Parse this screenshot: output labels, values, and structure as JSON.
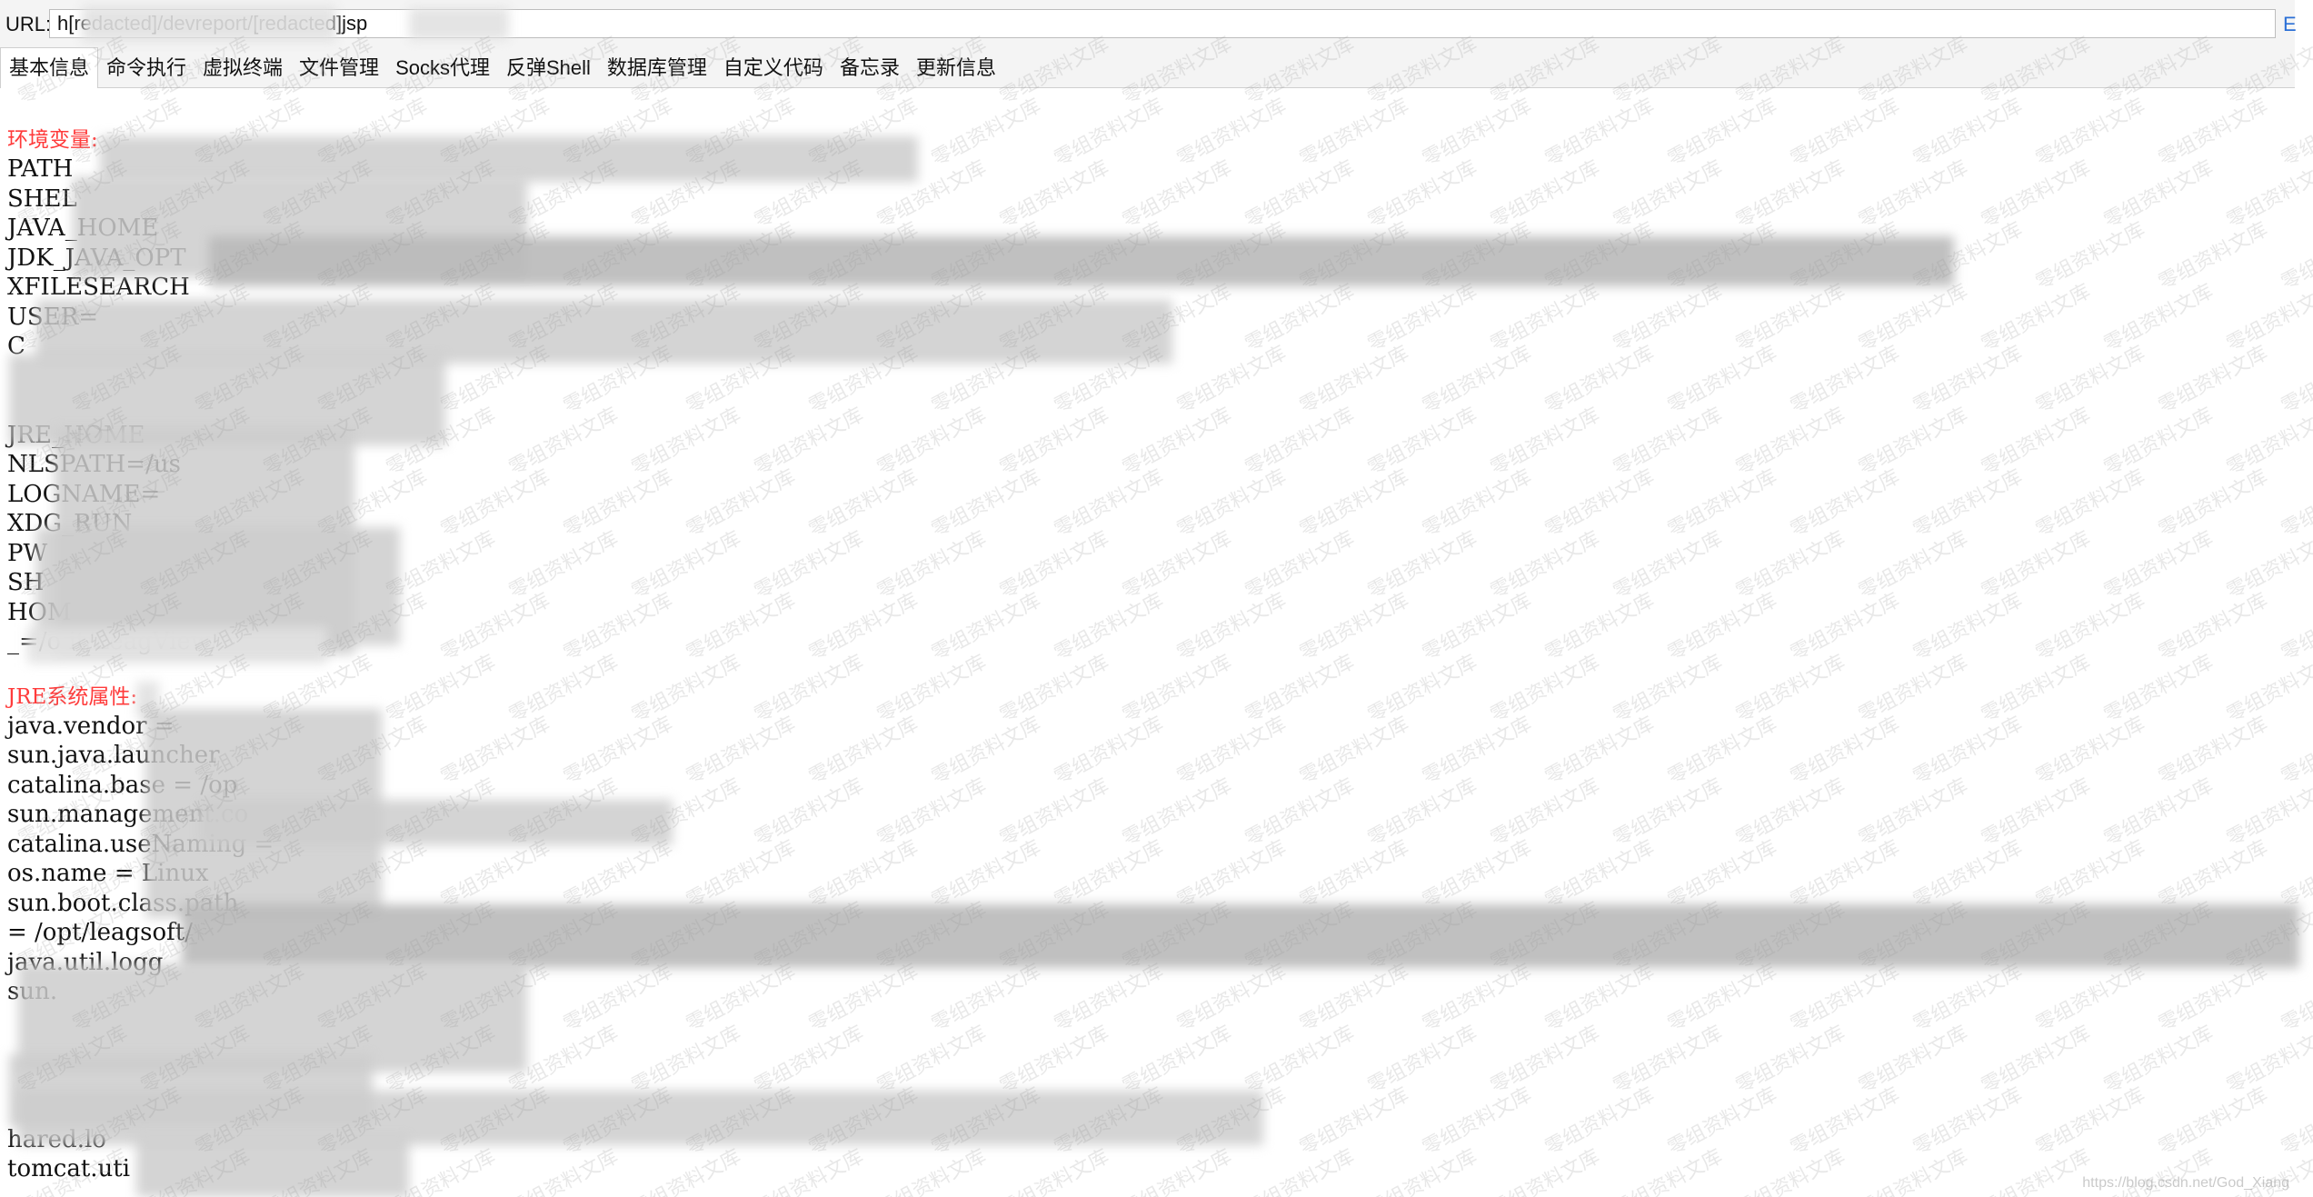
{
  "url_bar": {
    "label": "URL:",
    "value": "h[redacted]/devreport/[redacted]jsp",
    "go_glyph": "E"
  },
  "tabs": [
    {
      "label": "基本信息",
      "active": true
    },
    {
      "label": "命令执行",
      "active": false
    },
    {
      "label": "虚拟终端",
      "active": false
    },
    {
      "label": "文件管理",
      "active": false
    },
    {
      "label": "Socks代理",
      "active": false
    },
    {
      "label": "反弹Shell",
      "active": false
    },
    {
      "label": "数据库管理",
      "active": false
    },
    {
      "label": "自定义代码",
      "active": false
    },
    {
      "label": "备忘录",
      "active": false
    },
    {
      "label": "更新信息",
      "active": false
    }
  ],
  "env_section": {
    "title": "环境变量:",
    "lines": [
      "PATH",
      "SHEL",
      "JAVA_HOME",
      "JDK_JAVA_OPT",
      "XFILESEARCH",
      "USER=",
      "C",
      "",
      "",
      "JRE_HOME",
      "NLSPATH=/us",
      "LOGNAME=",
      "XDG_RUN",
      "PW",
      "SH",
      "HOM",
      "_=/o          it/LeagView/"
    ]
  },
  "jre_section": {
    "title": "JRE系统属性:",
    "lines": [
      "java.vendor =",
      "sun.java.launcher",
      "catalina.base = /op",
      "sun.management.co",
      "catalina.useNaming =",
      "os.name = Linux",
      "sun.boot.class.path",
      "= /opt/leagsoft/",
      "java.util.logg",
      "sun.",
      "",
      "",
      "",
      "",
      "hared.lo",
      "tomcat.uti",
      ""
    ]
  },
  "watermark": {
    "text": "零组资料文库",
    "footer": "https://blog.csdn.net/God_Xiang"
  },
  "colors": {
    "section_title": "#ff3b3b",
    "toolbar_bg": "#f4f4f4",
    "text": "#111111"
  }
}
